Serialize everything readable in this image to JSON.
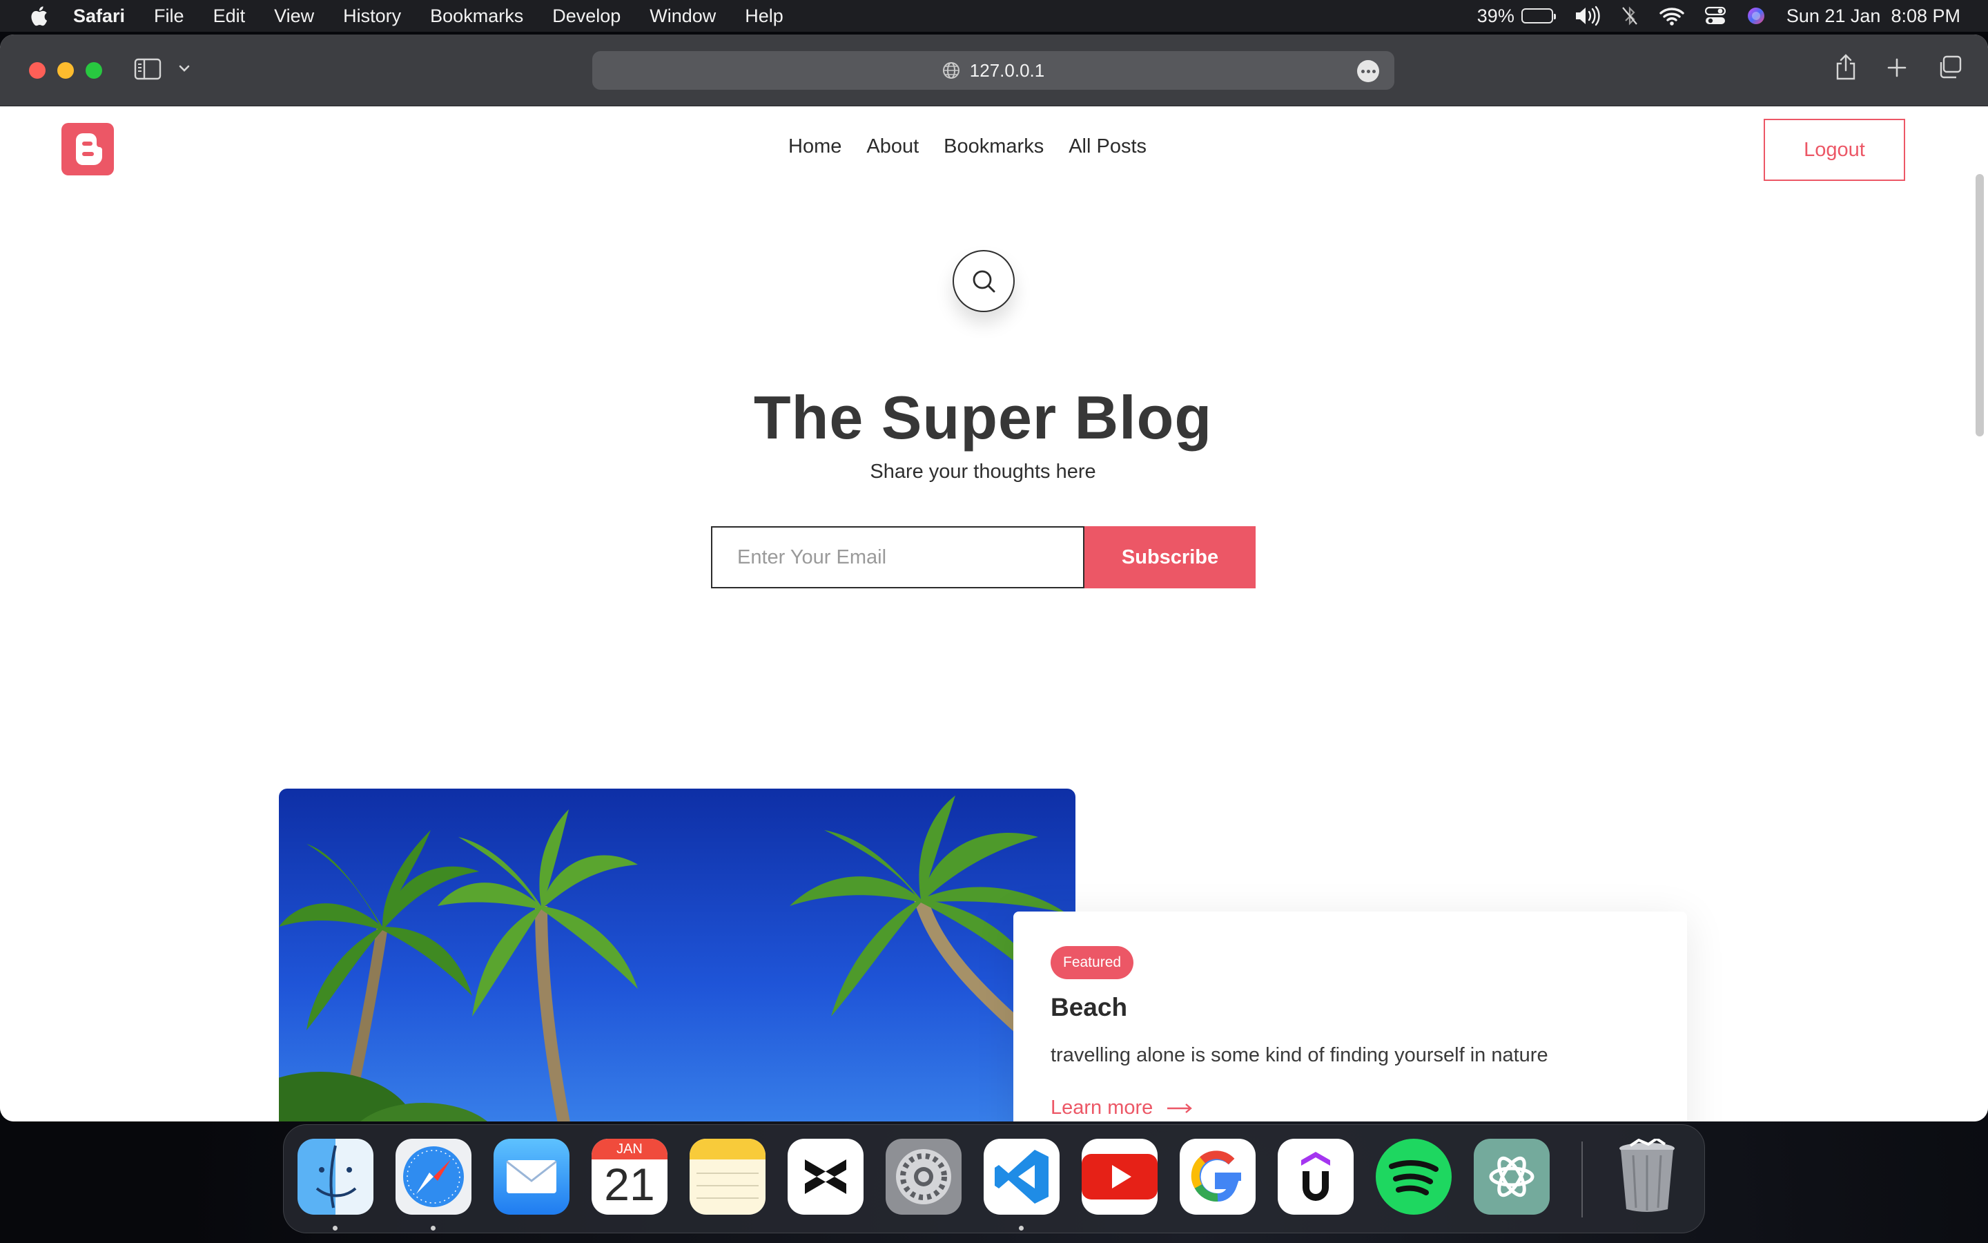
{
  "menubar": {
    "app_name": "Safari",
    "items": [
      "File",
      "Edit",
      "View",
      "History",
      "Bookmarks",
      "Develop",
      "Window",
      "Help"
    ],
    "battery_percent": "39%",
    "battery_level": 0.39,
    "clock": "Sun 21 Jan  8:08 PM"
  },
  "browser": {
    "url": "127.0.0.1"
  },
  "site": {
    "nav": [
      "Home",
      "About",
      "Bookmarks",
      "All Posts"
    ],
    "logout_label": "Logout",
    "hero_title": "The Super Blog",
    "hero_subtitle": "Share your thoughts here",
    "email_placeholder": "Enter Your Email",
    "subscribe_label": "Subscribe",
    "featured_post": {
      "badge": "Featured",
      "title": "Beach",
      "excerpt": "travelling alone is some kind of finding yourself in nature",
      "link_label": "Learn more"
    }
  },
  "dock": {
    "apps": [
      "finder-icon",
      "safari-icon",
      "mail-icon",
      "calendar-icon",
      "notes-icon",
      "capcut-icon",
      "system-settings-icon",
      "vscode-icon",
      "youtube-icon",
      "google-icon",
      "udemy-icon",
      "spotify-icon",
      "chatgpt-icon",
      "trash-icon"
    ],
    "calendar_month": "JAN",
    "calendar_day": "21"
  },
  "colors": {
    "accent": "#ec5766",
    "toolbar": "#3d3e42",
    "menubar": "#1d1e22"
  }
}
